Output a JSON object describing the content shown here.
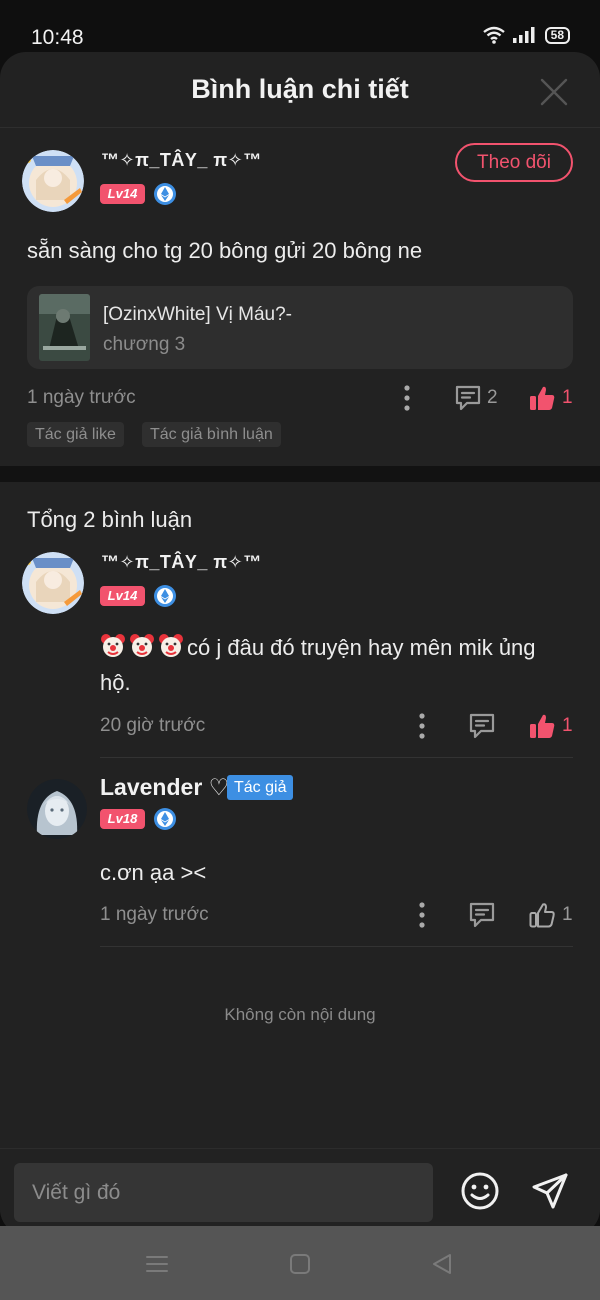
{
  "status_bar": {
    "time": "10:48",
    "battery": "58"
  },
  "sheet": {
    "title": "Bình luận chi tiết"
  },
  "post": {
    "username": "™✧π_TÂY_ π✧™",
    "level": "Lv14",
    "follow_label": "Theo dõi",
    "text": "sẵn sàng cho tg 20 bông gửi 20 bông ne",
    "story": {
      "title": "[OzinxWhite] Vị Máu?-",
      "chapter": "chương 3"
    },
    "time": "1 ngày trước",
    "reply_count": "2",
    "like_count": "1",
    "tags": [
      "Tác giả like",
      "Tác giả bình luận"
    ]
  },
  "comments_section": {
    "total_label": "Tổng 2 bình luận",
    "comments": [
      {
        "username": "™✧π_TÂY_ π✧™",
        "level": "Lv14",
        "text_line1": "có j đâu đó truyện hay  mên mik ủng",
        "text_line2": "hộ.",
        "time": "20 giờ trước",
        "like_count": "1",
        "liked": true
      },
      {
        "username": "Lavender ♡",
        "author_tag": "Tác giả",
        "level": "Lv18",
        "text": "c.ơn ạa ><",
        "time": "1 ngày trước",
        "like_count": "1",
        "liked": false
      }
    ],
    "end_label": "Không còn nội dung"
  },
  "input": {
    "placeholder": "Viết gì đó"
  },
  "icons": {
    "close": "close-icon",
    "more": "more-vertical-icon",
    "reply": "comment-icon",
    "like": "thumbs-up-icon",
    "emoji": "smiley-icon",
    "send": "send-icon"
  },
  "colors": {
    "accent": "#f2536e",
    "author_tag": "#3d8fe3",
    "background": "#222222"
  }
}
